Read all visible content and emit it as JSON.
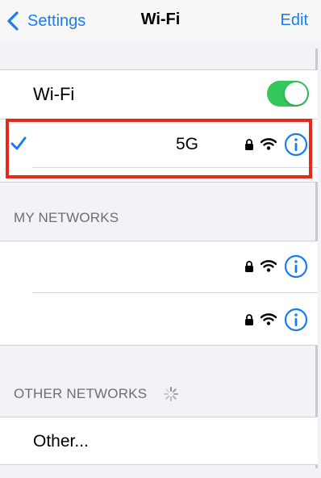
{
  "nav": {
    "back_label": "Settings",
    "title": "Wi-Fi",
    "edit_label": "Edit"
  },
  "wifi_toggle": {
    "label": "Wi-Fi",
    "enabled": true
  },
  "connected_network": {
    "name": "5G",
    "secured": true,
    "selected": true
  },
  "my_networks": {
    "header": "MY NETWORKS",
    "items": [
      {
        "name": "",
        "secured": true
      },
      {
        "name": "",
        "secured": true
      }
    ]
  },
  "other_networks": {
    "header": "OTHER NETWORKS",
    "other_label": "Other..."
  },
  "colors": {
    "accent": "#1a7cf4",
    "toggle_on": "#34c759",
    "highlight": "#e8281c"
  }
}
